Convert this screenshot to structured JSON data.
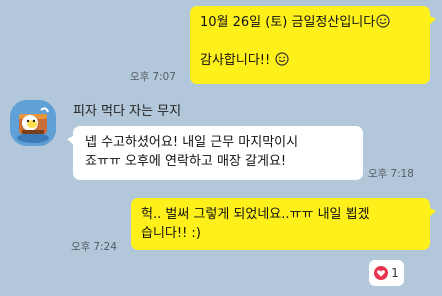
{
  "messages": {
    "msg1": {
      "line1": "10월 26일 (토) 금일정산입니다",
      "line2": "감사합니다!! ",
      "time_ampm": "오후",
      "time": "7:07"
    },
    "msg2": {
      "sender": "피자 먹다 자는 무지",
      "line1": "넵 수고하셨어요! 내일 근무 마지막이시",
      "line2": "죠ㅠㅠ  오후에 연락하고 매장 갈게요!",
      "time_ampm": "오후",
      "time": "7:18"
    },
    "msg3": {
      "line1": "헉.. 벌써 그렇게 되었네요..ㅠㅠ 내일 뵙겠",
      "line2": "습니다!! :)",
      "time_ampm": "오후",
      "time": "7:24"
    }
  },
  "reaction": {
    "icon": "heart-icon",
    "count": "1",
    "color": "#e8344e"
  },
  "colors": {
    "background": "#b2c7d9",
    "outgoing_bubble": "#fef01b",
    "incoming_bubble": "#ffffff"
  }
}
